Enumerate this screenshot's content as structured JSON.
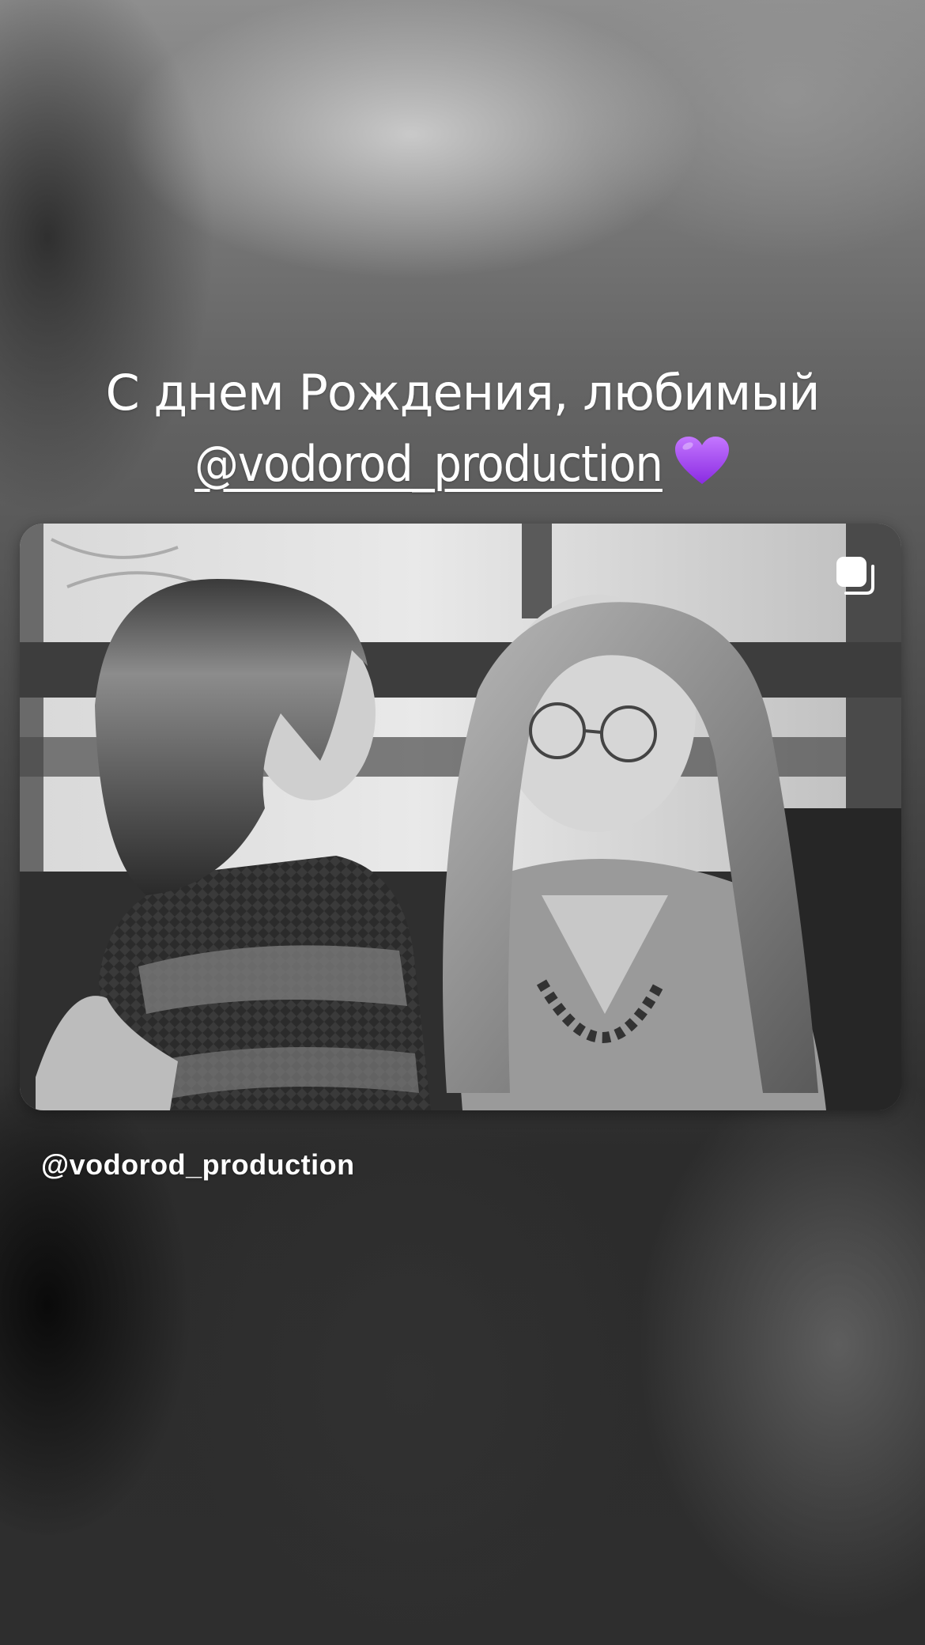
{
  "story": {
    "caption_line1": "С днем Рождения, любимый",
    "caption_mention": "@vodorod_production",
    "caption_emoji": "purple-heart-icon",
    "accent_color": "#a64bf4"
  },
  "shared_post": {
    "author": "@vodorod_production",
    "photo_style": "black-and-white",
    "badge_icon": "multiple-photos-icon"
  }
}
